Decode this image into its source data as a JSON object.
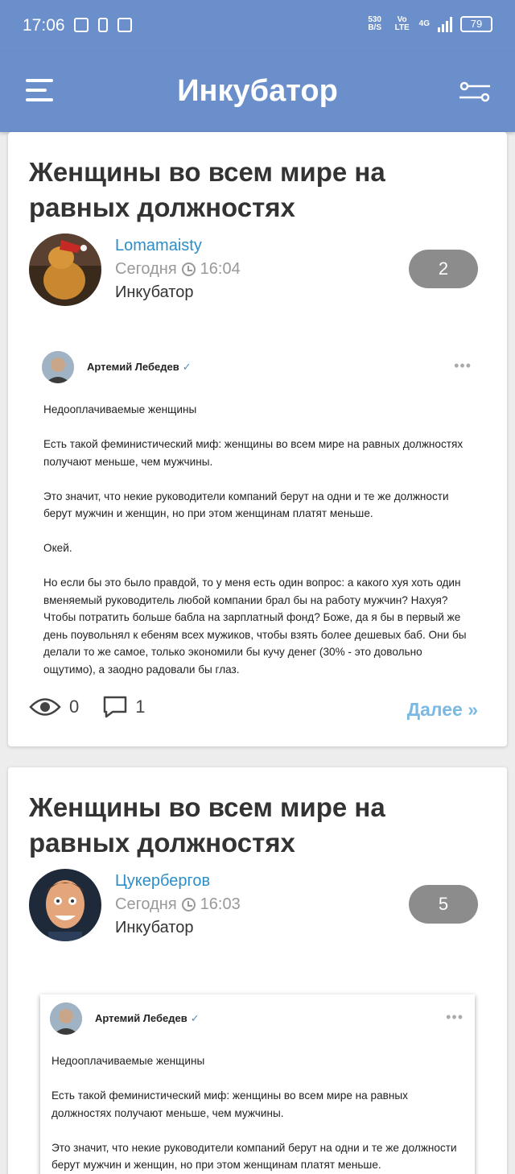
{
  "status_bar": {
    "time": "17:06",
    "net_speed": "530 B/S",
    "volte": "Vo LTE",
    "network": "4G",
    "battery": "79"
  },
  "app_bar": {
    "title": "Инкубатор"
  },
  "posts": [
    {
      "title": "Женщины во всем мире на равных должностях",
      "author": "Lomamaisty",
      "date": "Сегодня",
      "time": "16:04",
      "category": "Инкубатор",
      "badge": "2",
      "embed": {
        "author": "Артемий Лебедев",
        "verified": "✓",
        "dots": "•••",
        "paragraphs": [
          "Недооплачиваемые женщины",
          "Есть такой феминистический миф: женщины во всем мире на равных должностях получают меньше, чем мужчины.",
          "Это значит, что некие руководители компаний берут на одни и те же должности берут мужчин и женщин, но при этом женщинам платят меньше.",
          "Окей.",
          "Но если бы это было правдой, то у меня есть один вопрос: а какого хуя хоть один вменяемый руководитель любой компании брал бы на работу мужчин? Нахуя? Чтобы потратить больше бабла на зарплатный фонд? Боже, да я бы в первый же день поувольнял к ебеням всех мужиков, чтобы взять более дешевых баб. Они бы делали то же самое, только экономили бы кучу денег (30% - это довольно ощутимо), а заодно радовали бы глаз."
        ]
      },
      "views": "0",
      "comments": "1",
      "more_label": "Далее »"
    },
    {
      "title": "Женщины во всем мире на равных должностях",
      "author": "Цукербергов",
      "date": "Сегодня",
      "time": "16:03",
      "category": "Инкубатор",
      "badge": "5",
      "embed": {
        "author": "Артемий Лебедев",
        "verified": "✓",
        "dots": "•••",
        "paragraphs": [
          "Недооплачиваемые женщины",
          "Есть такой феминистический миф: женщины во всем мире на равных должностях получают меньше, чем мужчины.",
          "Это значит, что некие руководители компаний берут на одни и те же должности берут мужчин и женщин, но при этом женщинам платят меньше."
        ]
      }
    }
  ],
  "colors": {
    "accent": "#6a8fca",
    "link": "#2b8ec7",
    "more": "#7ab9e3",
    "badge": "#8c8c8c"
  }
}
